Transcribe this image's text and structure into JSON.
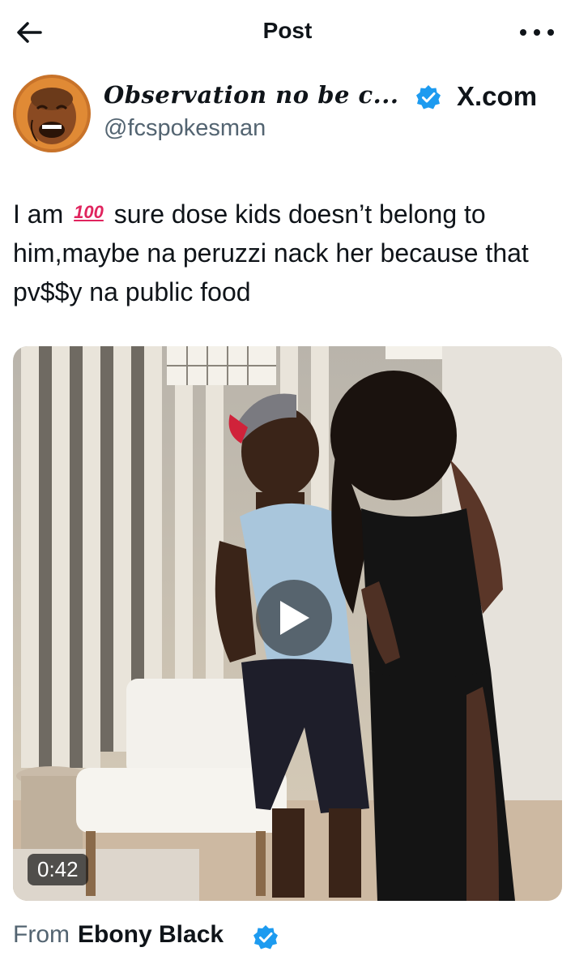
{
  "header": {
    "title": "Post"
  },
  "author": {
    "display_name": "Observation no be c...",
    "handle": "@fcspokesman",
    "site": "X.com"
  },
  "post": {
    "text_before_emoji": "I am",
    "emoji": "100",
    "text_after_emoji": "sure dose kids doesn’t belong to him,maybe na peruzzi nack her because that pv$$y na public food"
  },
  "video": {
    "duration": "0:42"
  },
  "source": {
    "prefix": "From",
    "name": "Ebony Black"
  },
  "colors": {
    "verified": "#1d9bf0",
    "text": "#0f1419",
    "muted": "#536471",
    "emoji_red": "#e0245e"
  },
  "icons": [
    "back-arrow-icon",
    "more-options-icon",
    "verified-badge-icon",
    "play-icon"
  ]
}
